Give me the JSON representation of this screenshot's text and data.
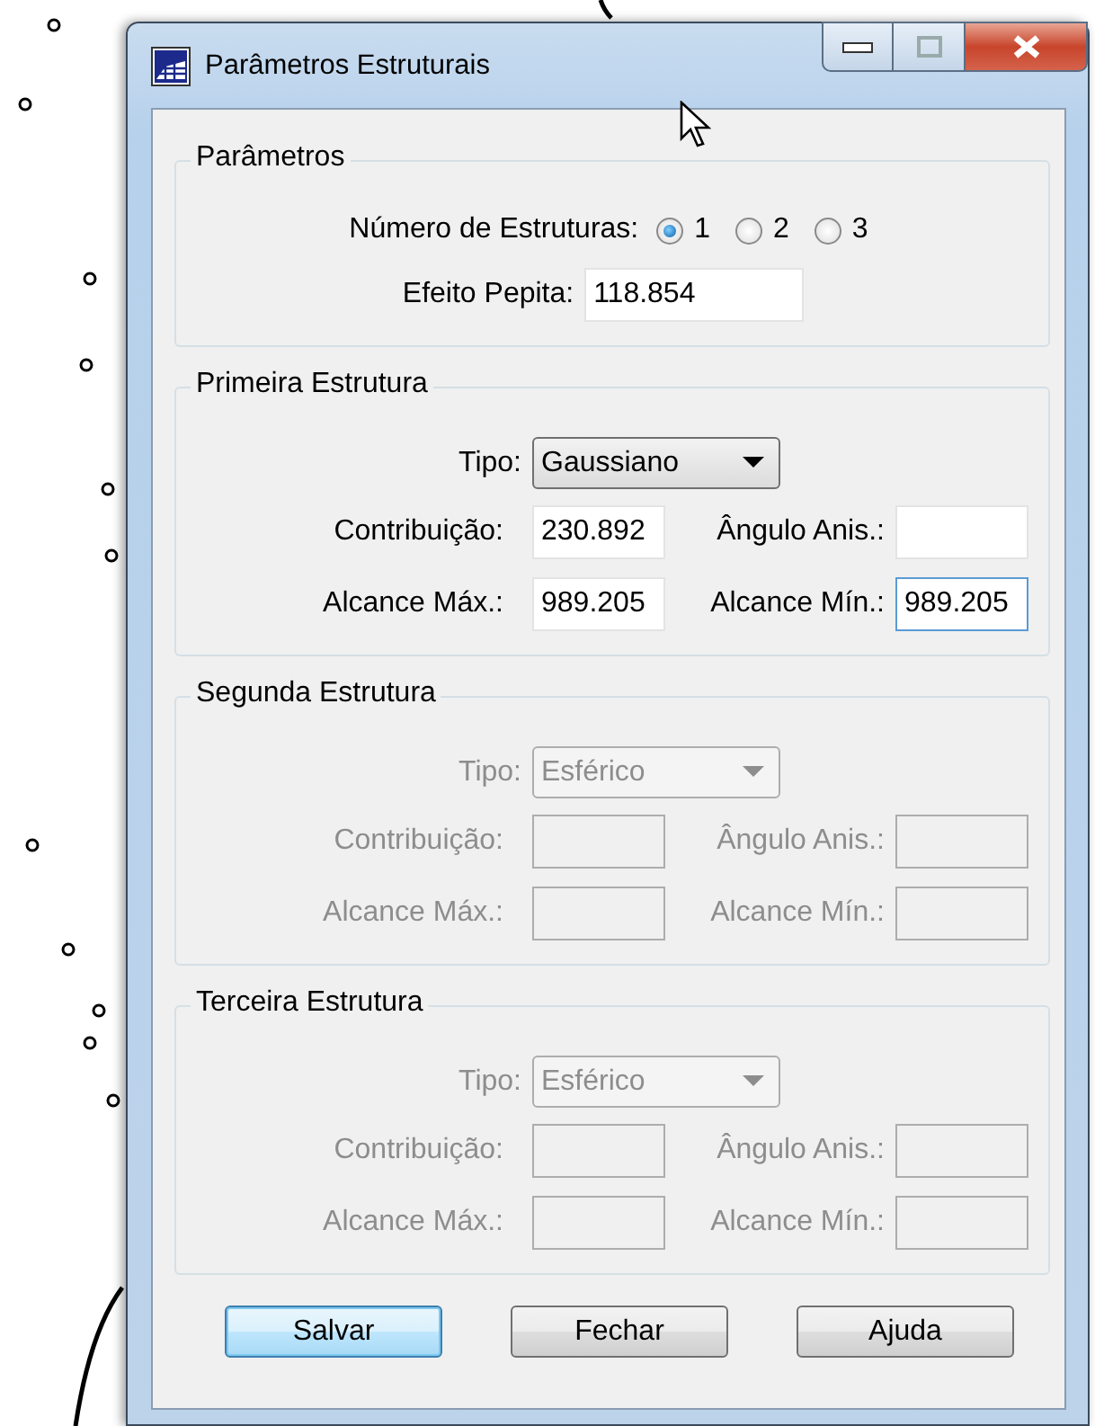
{
  "window": {
    "title": "Parâmetros Estruturais"
  },
  "parameters": {
    "title": "Parâmetros",
    "count_label": "Número de Estruturas:",
    "count_options": [
      {
        "label": "1",
        "selected": true
      },
      {
        "label": "2",
        "selected": false
      },
      {
        "label": "3",
        "selected": false
      }
    ],
    "nugget_label": "Efeito Pepita:",
    "nugget_value": "118.854"
  },
  "structures": [
    {
      "title": "Primeira Estrutura",
      "disabled": false,
      "type_label": "Tipo:",
      "type_value": "Gaussiano",
      "fields": [
        {
          "label": "Contribuição:",
          "value": "230.892",
          "focused": false
        },
        {
          "label": "Ângulo Anis.:",
          "focused": false
        },
        {
          "label": "Alcance Máx.:",
          "value": "989.205",
          "focused": false
        },
        {
          "label": "Alcance Mín.:",
          "value": "989.205",
          "focused": true
        }
      ]
    },
    {
      "title": "Segunda Estrutura",
      "disabled": true,
      "type_label": "Tipo:",
      "type_value": "Esférico",
      "fields": [
        {
          "label": "Contribuição:",
          "focused": false
        },
        {
          "label": "Ângulo Anis.:",
          "focused": false
        },
        {
          "label": "Alcance Máx.:",
          "focused": false
        },
        {
          "label": "Alcance Mín.:",
          "focused": false
        }
      ]
    },
    {
      "title": "Terceira Estrutura",
      "disabled": true,
      "type_label": "Tipo:",
      "type_value": "Esférico",
      "fields": [
        {
          "label": "Contribuição:",
          "focused": false
        },
        {
          "label": "Ângulo Anis.:",
          "focused": false
        },
        {
          "label": "Alcance Máx.:",
          "focused": false
        },
        {
          "label": "Alcance Mín.:",
          "focused": false
        }
      ]
    }
  ],
  "buttons": [
    {
      "label": "Salvar",
      "default": true
    },
    {
      "label": "Fechar",
      "default": false
    },
    {
      "label": "Ajuda",
      "default": false
    }
  ]
}
